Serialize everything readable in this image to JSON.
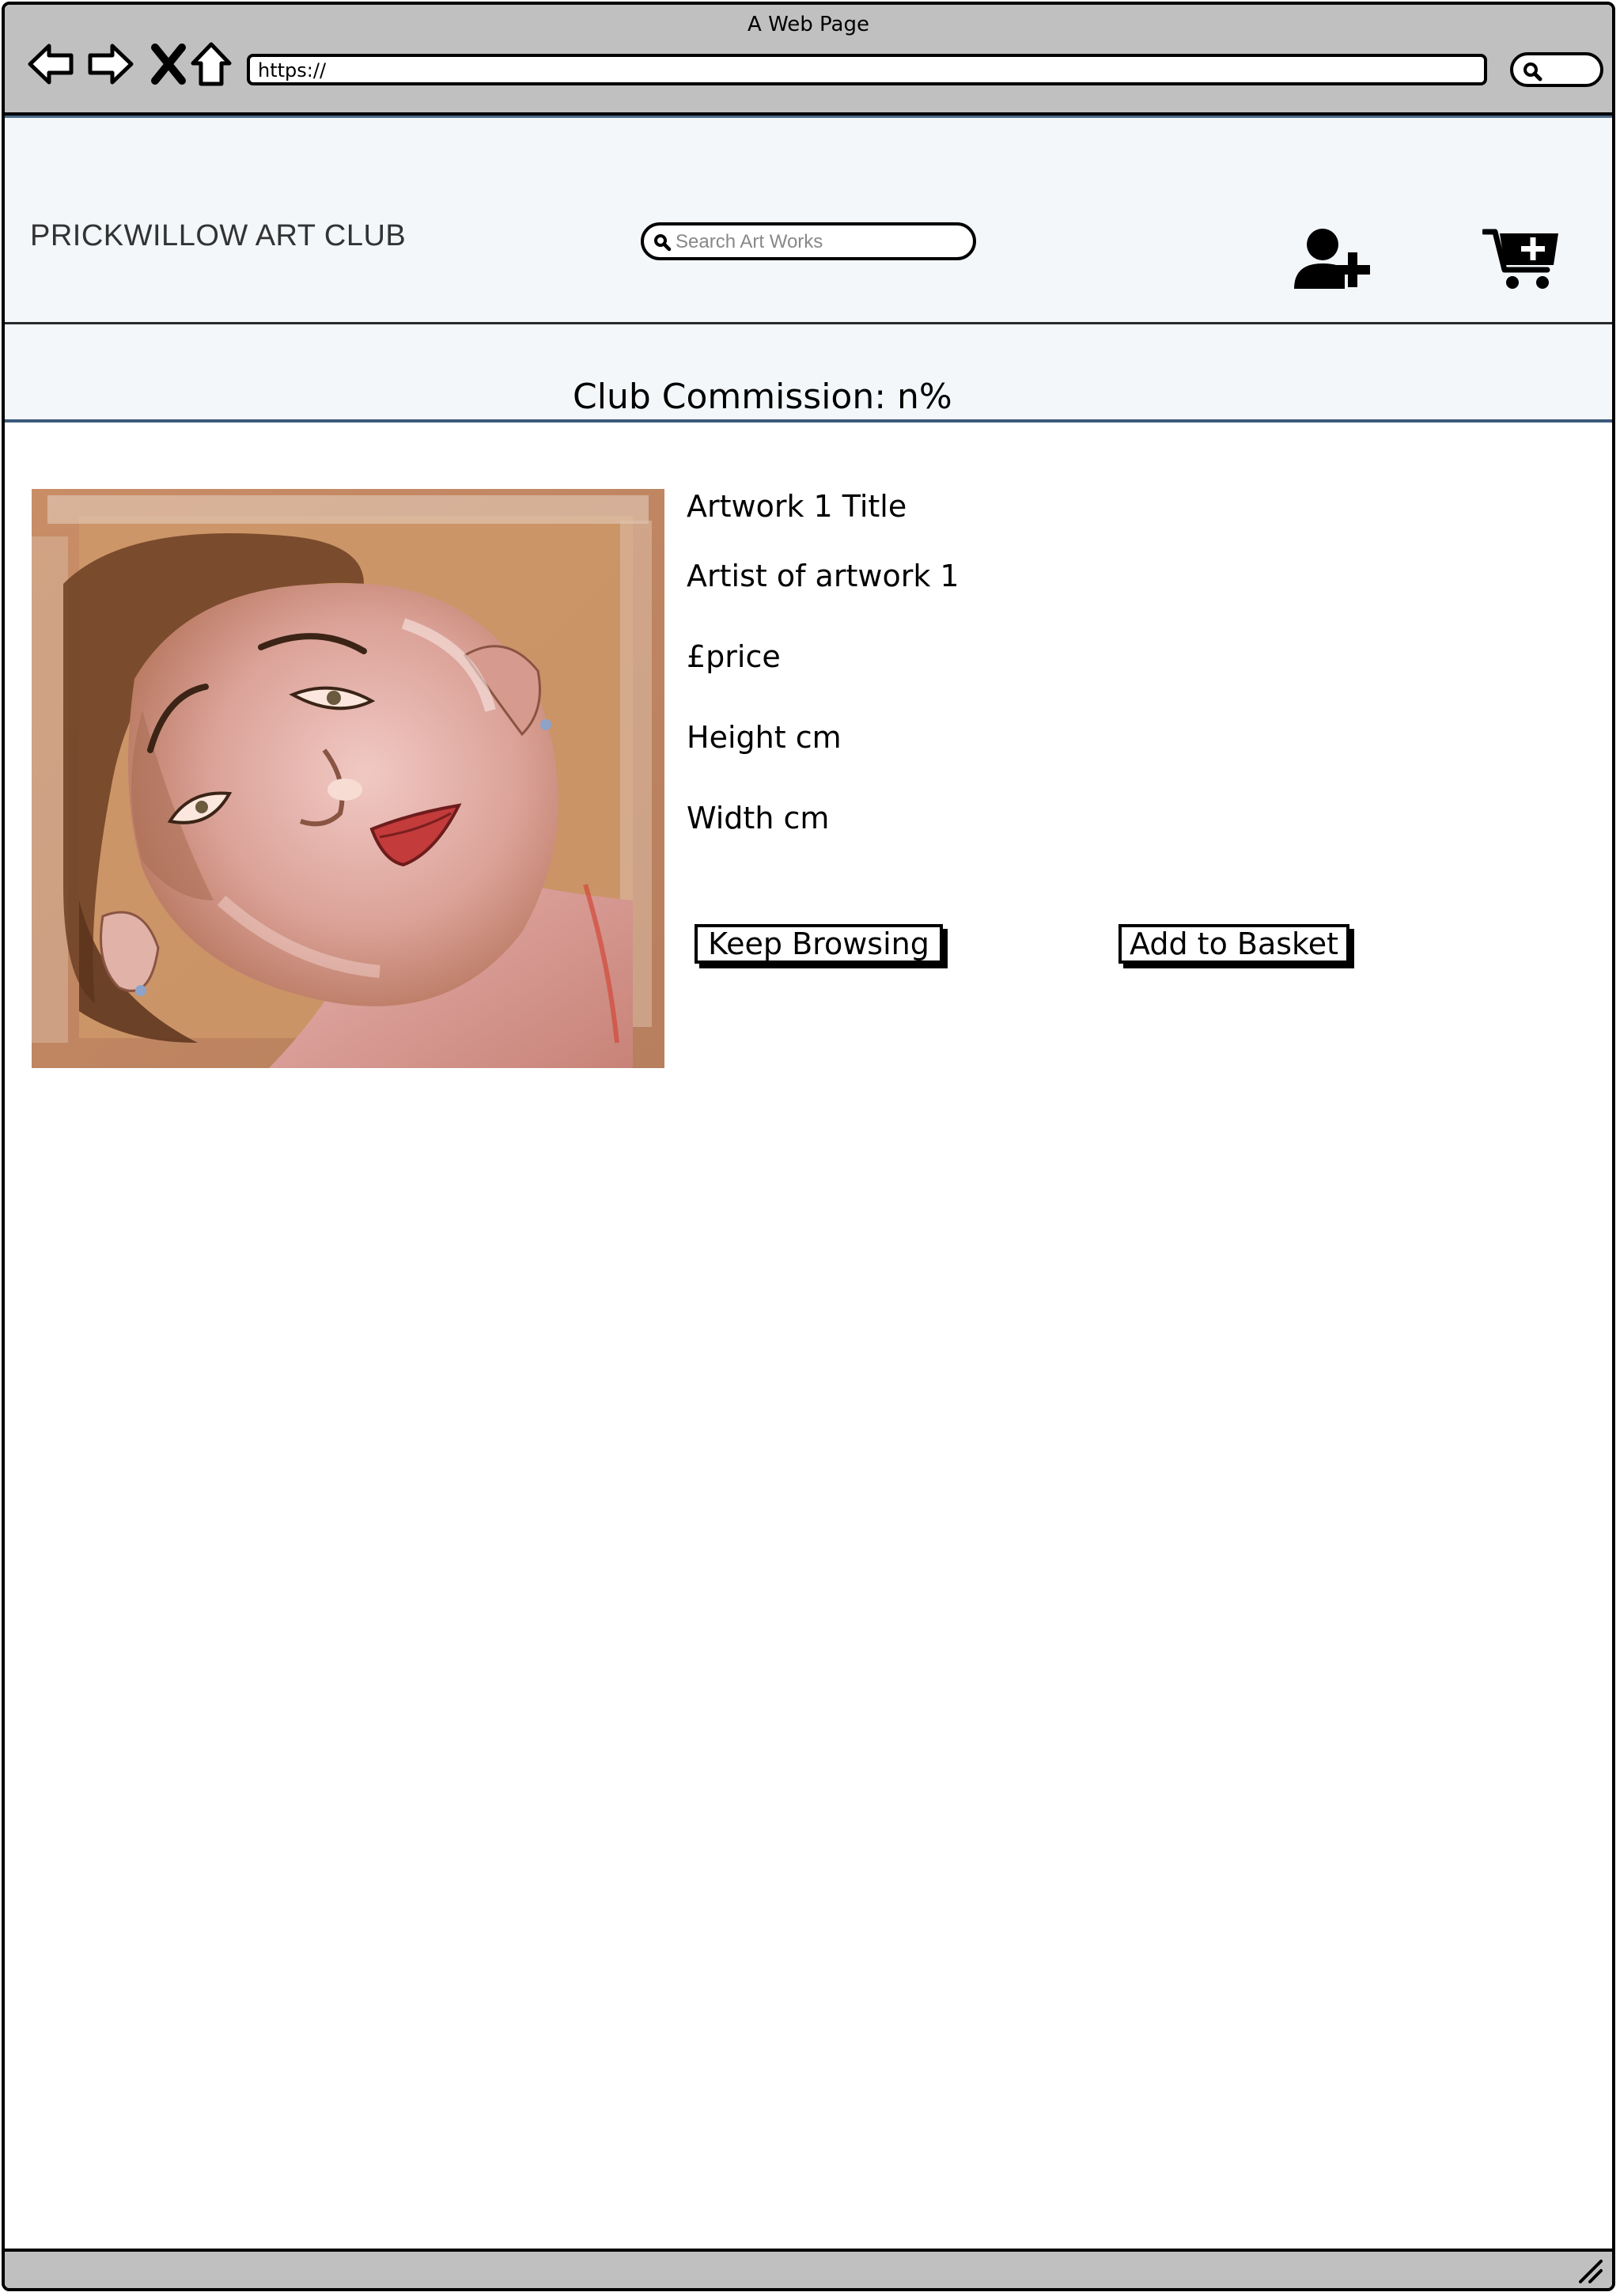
{
  "window": {
    "title": "A Web Page",
    "url": "https://"
  },
  "icons": {
    "back": "back-arrow-icon",
    "forward": "forward-arrow-icon",
    "stop": "close-icon",
    "home": "home-icon",
    "search": "search-icon",
    "register": "add-user-icon",
    "cart": "add-to-cart-icon",
    "resize": "resize-grip-icon"
  },
  "header": {
    "brand": "PRICKWILLOW ART CLUB",
    "search_placeholder": "Search Art Works"
  },
  "commission": {
    "label": "Club Commission: n%"
  },
  "artwork": {
    "image_alt": "pastel portrait of a woman's face",
    "title": "Artwork 1 Title",
    "artist": "Artist of artwork 1",
    "price": "£price",
    "height": "Height cm",
    "width": "Width cm"
  },
  "buttons": {
    "keep_browsing": "Keep Browsing",
    "add_to_basket": "Add to Basket"
  },
  "colors": {
    "chrome": "#c0c0c0",
    "header_bg": "#f3f7fa",
    "header_border": "#3a5a7a"
  }
}
